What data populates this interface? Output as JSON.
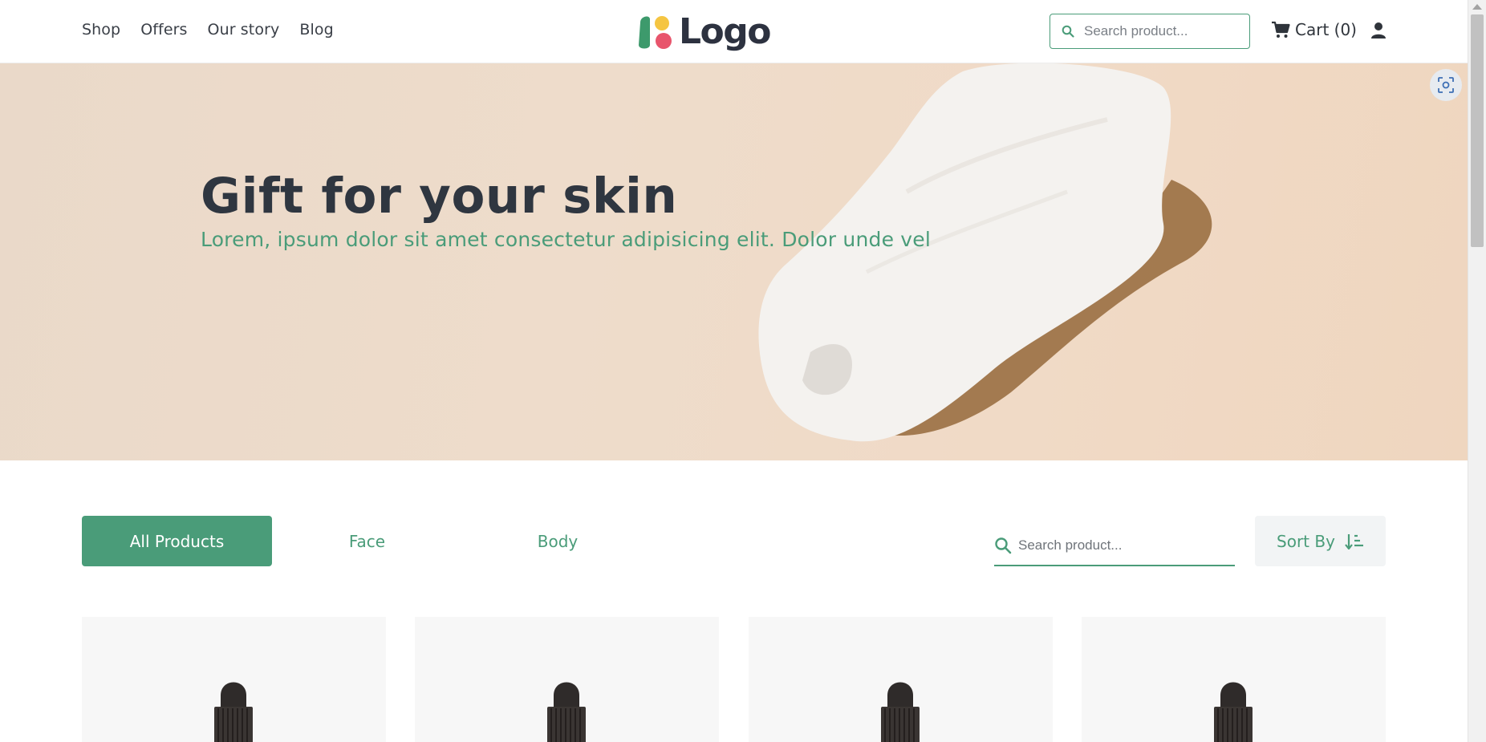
{
  "header": {
    "nav": [
      "Shop",
      "Offers",
      "Our story",
      "Blog"
    ],
    "logo_text": "Logo",
    "search_placeholder": "Search product...",
    "cart_label": "Cart (0)"
  },
  "hero": {
    "title": "Gift for your skin",
    "subtitle": "Lorem, ipsum dolor sit amet consectetur adipisicing elit. Dolor unde vel"
  },
  "filters": {
    "tabs": [
      "All Products",
      "Face",
      "Body"
    ],
    "active_tab": "All Products",
    "search_placeholder": "Search product...",
    "sort_label": "Sort By"
  },
  "products": {
    "card_count": 4
  },
  "colors": {
    "accent": "#4a9c79",
    "text_dark": "#2f343b",
    "hero_bg": "#eedccb",
    "logo_green": "#3d9a6c",
    "logo_yellow": "#f5c542",
    "logo_pink": "#e8556c"
  }
}
